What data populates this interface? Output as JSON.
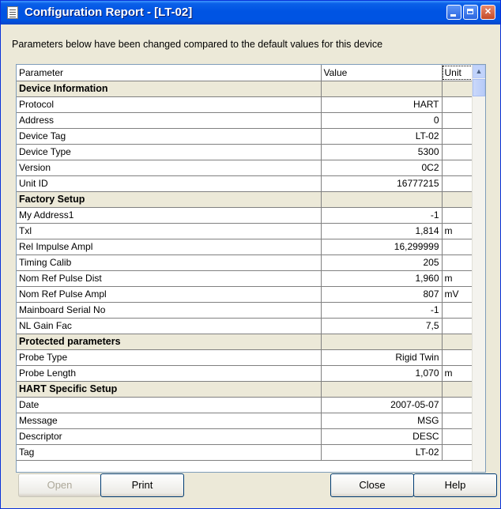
{
  "window": {
    "title": "Configuration Report - [LT-02]",
    "icon": "report-document-icon",
    "controls": {
      "minimize": "minimize-icon",
      "maximize": "maximize-icon",
      "close_glyph": "✕"
    }
  },
  "info_text": "Parameters below have been changed compared to the default values for this device",
  "table": {
    "headers": [
      "Parameter",
      "Value",
      "Unit"
    ],
    "rows": [
      {
        "type": "group",
        "parameter": "Device Information",
        "value": "",
        "unit": ""
      },
      {
        "type": "row",
        "parameter": "Protocol",
        "value": "HART",
        "unit": ""
      },
      {
        "type": "row",
        "parameter": "Address",
        "value": "0",
        "unit": ""
      },
      {
        "type": "row",
        "parameter": "Device Tag",
        "value": "LT-02",
        "unit": ""
      },
      {
        "type": "row",
        "parameter": "Device Type",
        "value": "5300",
        "unit": ""
      },
      {
        "type": "row",
        "parameter": "Version",
        "value": "0C2",
        "unit": ""
      },
      {
        "type": "row",
        "parameter": "Unit ID",
        "value": "16777215",
        "unit": ""
      },
      {
        "type": "group",
        "parameter": "Factory Setup",
        "value": "",
        "unit": ""
      },
      {
        "type": "row",
        "parameter": "My Address1",
        "value": "-1",
        "unit": ""
      },
      {
        "type": "row",
        "parameter": "Txl",
        "value": "1,814",
        "unit": "m"
      },
      {
        "type": "row",
        "parameter": "Rel Impulse Ampl",
        "value": "16,299999",
        "unit": ""
      },
      {
        "type": "row",
        "parameter": "Timing Calib",
        "value": "205",
        "unit": ""
      },
      {
        "type": "row",
        "parameter": "Nom Ref Pulse Dist",
        "value": "1,960",
        "unit": "m"
      },
      {
        "type": "row",
        "parameter": "Nom Ref Pulse Ampl",
        "value": "807",
        "unit": "mV"
      },
      {
        "type": "row",
        "parameter": "Mainboard Serial No",
        "value": "-1",
        "unit": ""
      },
      {
        "type": "row",
        "parameter": "NL Gain Fac",
        "value": "7,5",
        "unit": ""
      },
      {
        "type": "group",
        "parameter": "Protected parameters",
        "value": "",
        "unit": ""
      },
      {
        "type": "row",
        "parameter": "Probe Type",
        "value": "Rigid Twin",
        "unit": ""
      },
      {
        "type": "row",
        "parameter": "Probe Length",
        "value": "1,070",
        "unit": "m"
      },
      {
        "type": "group",
        "parameter": "HART Specific Setup",
        "value": "",
        "unit": ""
      },
      {
        "type": "row",
        "parameter": "Date",
        "value": "2007-05-07",
        "unit": ""
      },
      {
        "type": "row",
        "parameter": "Message",
        "value": "MSG",
        "unit": ""
      },
      {
        "type": "row",
        "parameter": "Descriptor",
        "value": "DESC",
        "unit": ""
      },
      {
        "type": "row",
        "parameter": "Tag",
        "value": "LT-02",
        "unit": ""
      }
    ]
  },
  "scrollbar": {
    "up_arrow": "▲"
  },
  "buttons": {
    "open": "Open",
    "print": "Print",
    "close": "Close",
    "help": "Help"
  }
}
